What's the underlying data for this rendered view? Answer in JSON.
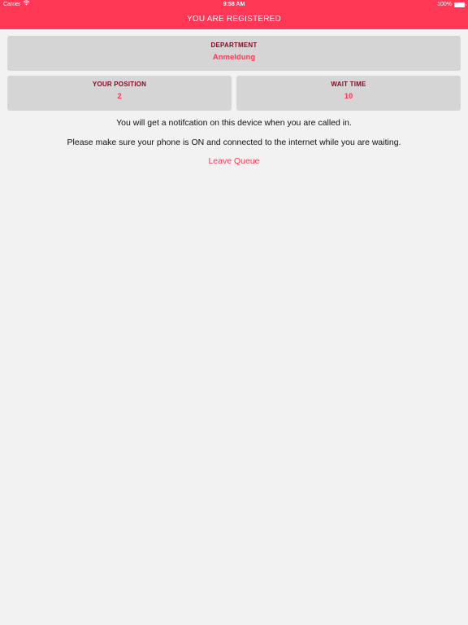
{
  "status_bar": {
    "carrier": "Carrier",
    "time": "9:58 AM",
    "battery": "100%",
    "battery_level": 1.0,
    "wifi_icon": "wifi-icon",
    "battery_icon": "battery-icon"
  },
  "header": {
    "title": "YOU ARE REGISTERED"
  },
  "department": {
    "label": "DEPARTMENT",
    "value": "Anmeldung"
  },
  "position": {
    "label": "YOUR POSITION",
    "value": "2"
  },
  "wait_time": {
    "label": "WAIT TIME",
    "value": "10"
  },
  "messages": {
    "notification": "You will get a notifcation on this device when you are called in.",
    "connection": "Please make sure your phone is ON and connected to the internet while you are waiting."
  },
  "actions": {
    "leave_queue": "Leave Queue"
  },
  "colors": {
    "accent": "#ff3856",
    "label_dark": "#7a0f22",
    "card_bg": "#d5d5d5",
    "page_bg": "#f2f2f2"
  }
}
